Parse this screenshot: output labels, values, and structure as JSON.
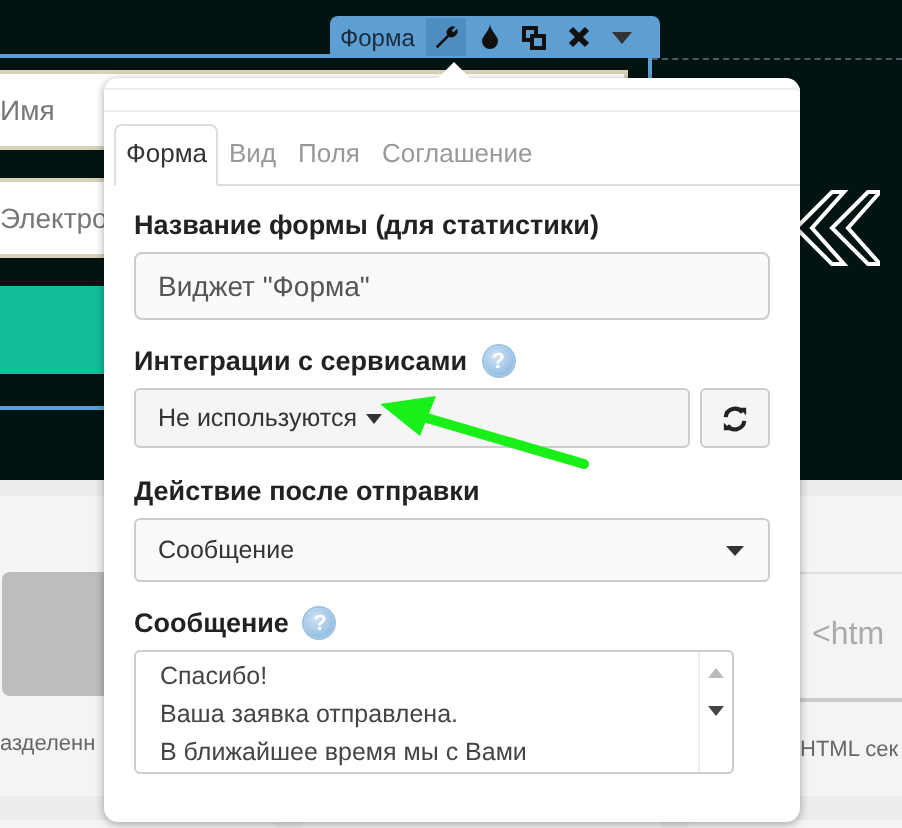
{
  "toolbar": {
    "title": "Форма"
  },
  "background": {
    "fields": [
      {
        "placeholder": "Имя"
      },
      {
        "placeholder": "Электро"
      }
    ],
    "blocks": [
      {
        "kind": "image",
        "caption": "азделенн"
      },
      {
        "kind": "html",
        "code": "<htm",
        "caption": "HTML сек"
      }
    ]
  },
  "popup": {
    "tabs": [
      {
        "label": "Форма",
        "selected": true
      },
      {
        "label": "Вид",
        "selected": false
      },
      {
        "label": "Поля",
        "selected": false
      },
      {
        "label": "Соглашение",
        "selected": false
      }
    ],
    "form_name": {
      "label": "Название формы (для статистики)",
      "value": "Виджет \"Форма\""
    },
    "integrations": {
      "label": "Интеграции с сервисами",
      "help": "?",
      "value": "Не используются"
    },
    "action": {
      "label": "Действие после отправки",
      "value": "Сообщение"
    },
    "message": {
      "label": "Сообщение",
      "help": "?",
      "value": "Спасибо!\nВаша заявка отправлена.\nВ ближайшее время мы с Вами"
    }
  }
}
